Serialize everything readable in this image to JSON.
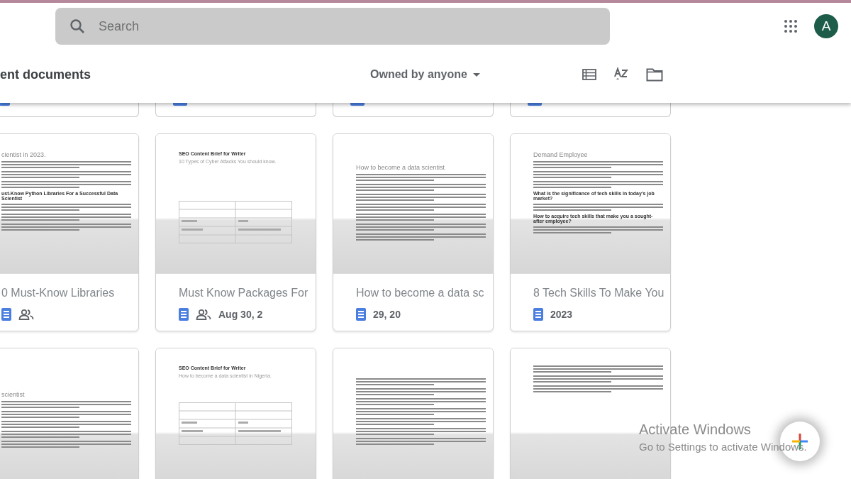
{
  "search": {
    "placeholder": "Search"
  },
  "account": {
    "initial": "A"
  },
  "section": {
    "title": "ent documents",
    "owner_filter": "Owned by anyone"
  },
  "top_row_cards": [
    {
      "kind": "document"
    },
    {
      "kind": "document"
    },
    {
      "kind": "document"
    },
    {
      "kind": "document"
    }
  ],
  "cards": [
    {
      "title": "0 Must-Know Libraries",
      "shared": true,
      "preview": [
        {
          "kind": "title",
          "text": "cientist in 2023."
        },
        {
          "kind": "lines"
        },
        {
          "kind": "lines"
        },
        {
          "kind": "lines"
        },
        {
          "kind": "heading",
          "text": "ust-Know Python Libraries For a Successful Data Scientist"
        },
        {
          "kind": "lines"
        },
        {
          "kind": "lines"
        },
        {
          "kind": "lines"
        }
      ]
    },
    {
      "title": "Must Know Packages For",
      "date": "Aug 30, 2",
      "shared": true,
      "preview": [
        {
          "kind": "heading",
          "text": "SEO Content Brief for Writer"
        },
        {
          "kind": "subtitle",
          "text": "10 Types of Cyber Attacks You should know."
        },
        {
          "kind": "gap"
        },
        {
          "kind": "table"
        }
      ]
    },
    {
      "title": "How to become a data sc",
      "date": "29, 20",
      "shared": false,
      "preview": [
        {
          "kind": "gap"
        },
        {
          "kind": "title",
          "text": "How to become a data scientist"
        },
        {
          "kind": "lines"
        },
        {
          "kind": "lines"
        },
        {
          "kind": "lines"
        },
        {
          "kind": "lines"
        },
        {
          "kind": "lines"
        },
        {
          "kind": "lines"
        },
        {
          "kind": "lines"
        }
      ]
    },
    {
      "title": "8 Tech Skills To Make You",
      "date": "2023",
      "shared": false,
      "preview": [
        {
          "kind": "title",
          "text": "Demand Employee"
        },
        {
          "kind": "lines"
        },
        {
          "kind": "lines"
        },
        {
          "kind": "lines"
        },
        {
          "kind": "heading",
          "text": "What is the significance of tech skills in today's job market?"
        },
        {
          "kind": "lines"
        },
        {
          "kind": "heading",
          "text": "How to acquire tech skills that make you a sought-after employee?"
        },
        {
          "kind": "lines"
        }
      ]
    },
    {
      "preview": [
        {
          "kind": "gap"
        },
        {
          "kind": "gap"
        },
        {
          "kind": "title",
          "text": "scientist"
        },
        {
          "kind": "lines"
        },
        {
          "kind": "lines"
        },
        {
          "kind": "lines"
        },
        {
          "kind": "lines"
        },
        {
          "kind": "lines"
        }
      ]
    },
    {
      "preview": [
        {
          "kind": "heading",
          "text": "SEO Content Brief for Writer"
        },
        {
          "kind": "subtitle",
          "text": "How to become a data scientist in Nigeria."
        },
        {
          "kind": "table"
        }
      ]
    },
    {
      "preview": [
        {
          "kind": "gap"
        },
        {
          "kind": "lines"
        },
        {
          "kind": "lines"
        },
        {
          "kind": "lines"
        },
        {
          "kind": "lines"
        },
        {
          "kind": "lines"
        },
        {
          "kind": "lines"
        },
        {
          "kind": "lines"
        }
      ]
    },
    {
      "preview": [
        {
          "kind": "lines"
        },
        {
          "kind": "lines"
        },
        {
          "kind": "lines"
        }
      ]
    }
  ],
  "os_notice": {
    "title": "Activate Windows",
    "message": "Go to Settings to activate Windows."
  }
}
